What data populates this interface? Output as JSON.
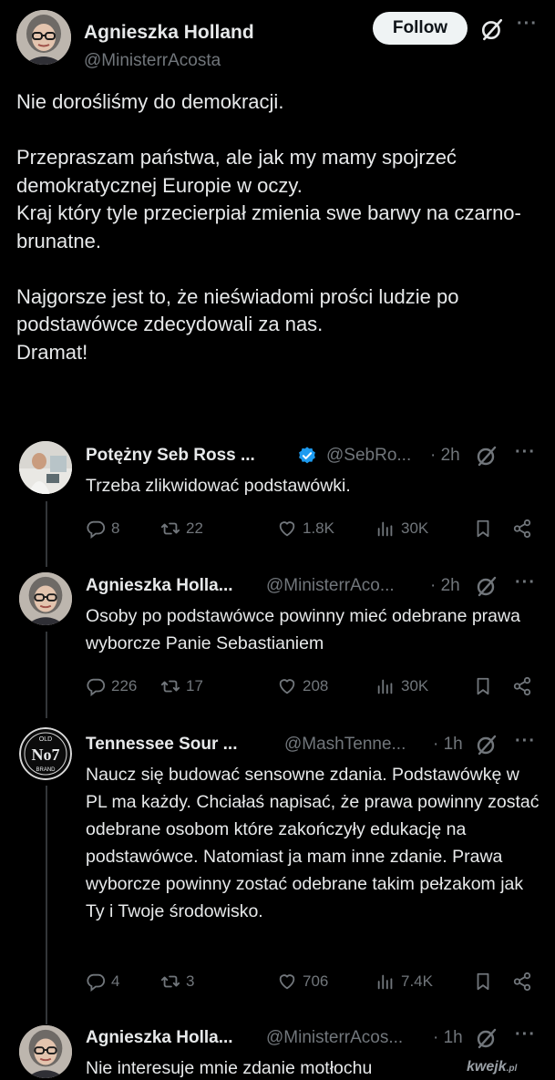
{
  "main_post": {
    "author_name": "Agnieszka Holland",
    "handle": "@MinisterrAcosta",
    "follow_label": "Follow",
    "more_label": "···",
    "text": "Nie dorośliśmy do demokracji.\n\nPrzepraszam państwa, ale jak my mamy spojrzeć demokratycznej Europie w oczy.\nKraj który tyle przecierpiał zmienia swe barwy na czarno- brunatne.\n\nNajgorsze jest to, że nieświadomi prości ludzie po podstawówce zdecydowali za nas.\nDramat!"
  },
  "replies": [
    {
      "author_name": "Potężny Seb Ross ...",
      "verified": true,
      "handle": "@SebRo...",
      "time": "· 2h",
      "more_label": "···",
      "text": "Trzeba zlikwidować podstawówki.",
      "replies_count": "8",
      "reposts_count": "22",
      "likes_count": "1.8K",
      "views_count": "30K"
    },
    {
      "author_name": "Agnieszka Holla...",
      "verified": false,
      "handle": "@MinisterrAco...",
      "time": "· 2h",
      "more_label": "···",
      "text": "Osoby po podstawówce powinny mieć odebrane prawa wyborcze Panie Sebastianiem",
      "replies_count": "226",
      "reposts_count": "17",
      "likes_count": "208",
      "views_count": "30K"
    },
    {
      "author_name": "Tennessee Sour ...",
      "verified": false,
      "handle": "@MashTenne...",
      "time": "· 1h",
      "more_label": "···",
      "text": "Naucz się budować sensowne zdania. Podstawówkę w PL ma każdy. Chciałaś napisać, że prawa powinny zostać odebrane osobom które zakończyły edukację na podstawówce. Natomiast ja mam inne zdanie. Prawa wyborcze powinny zostać odebrane takim pełzakom jak Ty i Twoje środowisko.",
      "replies_count": "4",
      "reposts_count": "3",
      "likes_count": "706",
      "views_count": "7.4K",
      "avatar_label_top": "OLD",
      "avatar_label_mid": "No7",
      "avatar_label_bottom": "BRAND"
    },
    {
      "author_name": "Agnieszka Holla...",
      "verified": false,
      "handle": "@MinisterrAcos...",
      "time": "· 1h",
      "more_label": "···",
      "text": "Nie interesuje mnie zdanie motłochu"
    }
  ],
  "watermark": {
    "brand": "kwejk",
    "tld": ".pl"
  },
  "colors": {
    "background": "#000000",
    "text": "#e7e9ea",
    "secondary": "#71767b",
    "verified": "#1d9bf0",
    "follow_bg": "#eff3f4"
  },
  "icons": [
    "grok-icon",
    "more-icon",
    "verified-badge-icon",
    "reply-icon",
    "repost-icon",
    "like-icon",
    "views-icon",
    "bookmark-icon",
    "share-icon"
  ]
}
